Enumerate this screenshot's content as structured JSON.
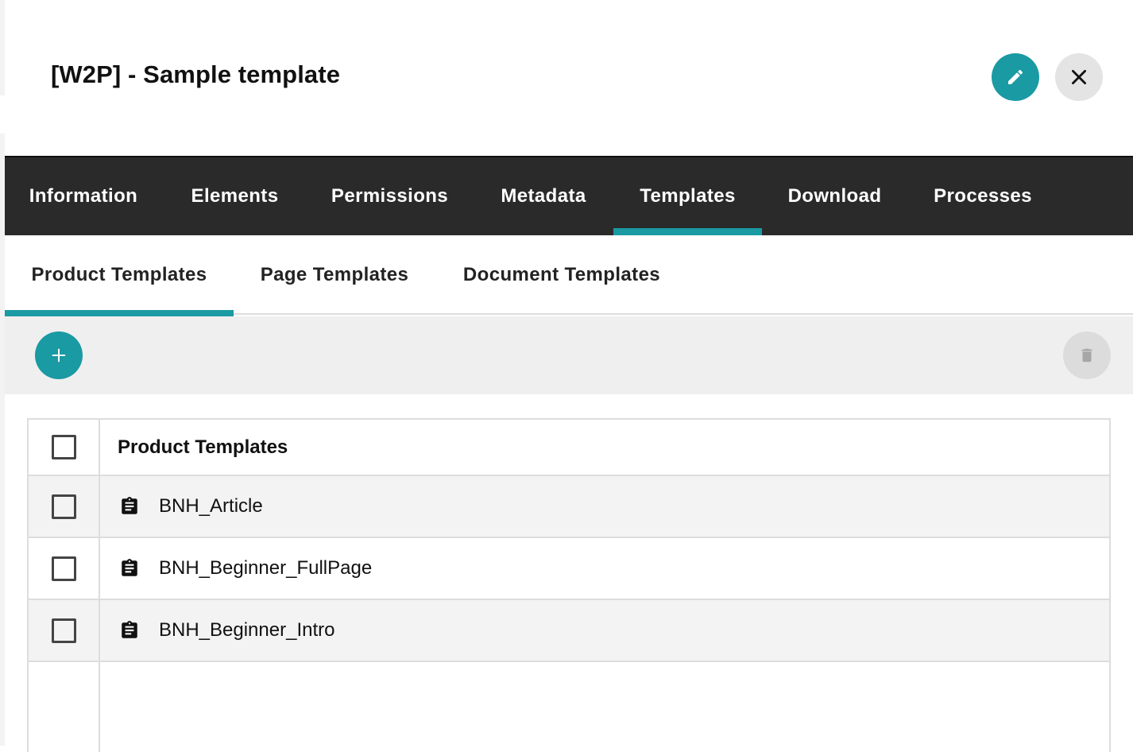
{
  "header": {
    "title": "[W2P] - Sample template",
    "edit_icon": "pencil-icon",
    "close_icon": "close-icon"
  },
  "main_tabs": [
    {
      "label": "Information"
    },
    {
      "label": "Elements"
    },
    {
      "label": "Permissions"
    },
    {
      "label": "Metadata"
    },
    {
      "label": "Templates",
      "active": true
    },
    {
      "label": "Download"
    },
    {
      "label": "Processes"
    }
  ],
  "sub_tabs": [
    {
      "label": "Product Templates",
      "active": true
    },
    {
      "label": "Page Templates"
    },
    {
      "label": "Document Templates"
    }
  ],
  "toolbar": {
    "add_icon": "plus-icon",
    "delete_icon": "trash-icon"
  },
  "table": {
    "column_header": "Product Templates",
    "rows": [
      {
        "label": "BNH_Article",
        "icon": "clipboard-icon"
      },
      {
        "label": "BNH_Beginner_FullPage",
        "icon": "clipboard-icon"
      },
      {
        "label": "BNH_Beginner_Intro",
        "icon": "clipboard-icon"
      }
    ]
  },
  "colors": {
    "accent": "#1a9aa3",
    "tab_bar": "#2a2a2a",
    "toolbar_bg": "#efefef",
    "row_alt_bg": "#f3f3f3"
  }
}
